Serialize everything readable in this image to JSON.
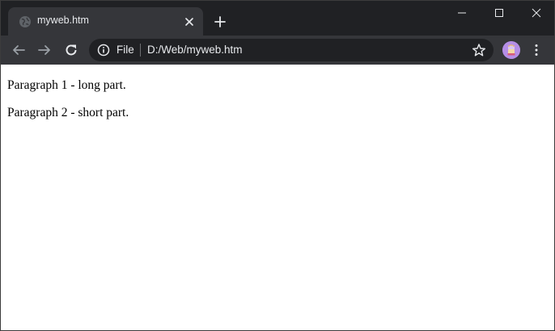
{
  "window": {
    "controls": {
      "minimize": "minimize",
      "maximize": "maximize",
      "close": "close"
    }
  },
  "tab": {
    "title": "myweb.htm",
    "favicon": "globe-icon"
  },
  "toolbar": {
    "back": "back-arrow-icon",
    "forward": "forward-arrow-icon",
    "reload": "reload-icon",
    "menu": "kebab-menu-icon"
  },
  "omnibox": {
    "scheme_label": "File",
    "url": "D:/Web/myweb.htm",
    "info_icon": "info-icon",
    "bookmark_icon": "star-icon"
  },
  "page": {
    "paragraphs": [
      "Paragraph 1 - long part.",
      "Paragraph 2 - short part."
    ]
  },
  "colors": {
    "tabstrip": "#202124",
    "toolbar": "#35363a",
    "omnibox": "#202124",
    "text_light": "#e8eaed",
    "avatar": "#b58ee6"
  }
}
